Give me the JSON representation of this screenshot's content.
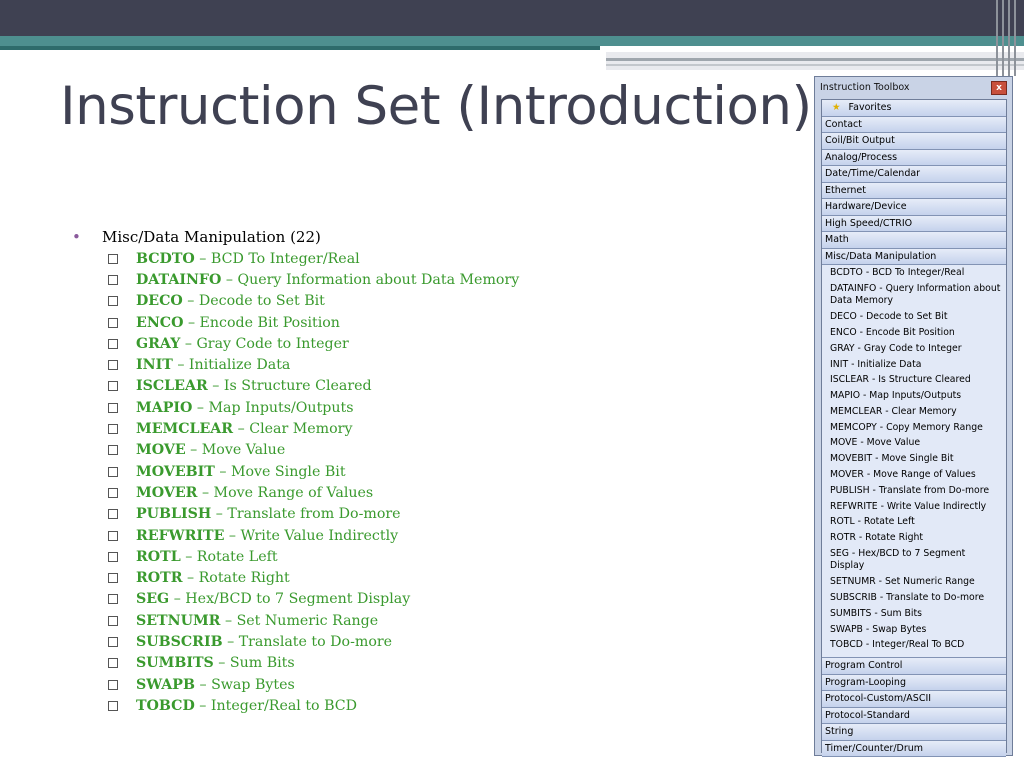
{
  "slide": {
    "title": "Instruction Set (Introduction)"
  },
  "content": {
    "section": "Misc/Data Manipulation (22)",
    "items": [
      {
        "code": "BCDTO",
        "desc": " – BCD To Integer/Real"
      },
      {
        "code": "DATAINFO",
        "desc": " – Query Information about Data Memory"
      },
      {
        "code": "DECO",
        "desc": " – Decode to Set Bit"
      },
      {
        "code": "ENCO",
        "desc": " – Encode Bit Position"
      },
      {
        "code": "GRAY",
        "desc": " – Gray Code to Integer"
      },
      {
        "code": "INIT",
        "desc": " – Initialize Data"
      },
      {
        "code": "ISCLEAR",
        "desc": " – Is Structure Cleared"
      },
      {
        "code": "MAPIO",
        "desc": " – Map Inputs/Outputs"
      },
      {
        "code": "MEMCLEAR",
        "desc": " – Clear Memory"
      },
      {
        "code": "MOVE",
        "desc": " – Move Value"
      },
      {
        "code": "MOVEBIT",
        "desc": " – Move Single Bit"
      },
      {
        "code": "MOVER",
        "desc": " – Move Range of Values"
      },
      {
        "code": "PUBLISH",
        "desc": " – Translate from Do-more"
      },
      {
        "code": "REFWRITE",
        "desc": " – Write Value Indirectly"
      },
      {
        "code": "ROTL",
        "desc": " – Rotate Left"
      },
      {
        "code": "ROTR",
        "desc": " – Rotate Right"
      },
      {
        "code": "SEG",
        "desc": " – Hex/BCD to 7 Segment Display"
      },
      {
        "code": "SETNUMR",
        "desc": " – Set Numeric Range"
      },
      {
        "code": "SUBSCRIB",
        "desc": " – Translate to Do-more"
      },
      {
        "code": "SUMBITS",
        "desc": " – Sum Bits"
      },
      {
        "code": "SWAPB",
        "desc": " – Swap Bytes"
      },
      {
        "code": "TOBCD",
        "desc": " – Integer/Real to BCD"
      }
    ]
  },
  "toolbox": {
    "title": "Instruction Toolbox",
    "close_label": "x",
    "favorites": "Favorites",
    "categories_top": [
      "Contact",
      "Coil/Bit Output",
      "Analog/Process",
      "Date/Time/Calendar",
      "Ethernet",
      "Hardware/Device",
      "High Speed/CTRIO",
      "Math",
      "Misc/Data Manipulation"
    ],
    "expanded_items": [
      "BCDTO - BCD To Integer/Real",
      "DATAINFO - Query Information about Data Memory",
      "DECO - Decode to Set Bit",
      "ENCO - Encode Bit Position",
      "GRAY - Gray Code to Integer",
      "INIT - Initialize Data",
      "ISCLEAR - Is Structure Cleared",
      "MAPIO - Map Inputs/Outputs",
      "MEMCLEAR - Clear Memory",
      "MEMCOPY - Copy Memory Range",
      "MOVE - Move Value",
      "MOVEBIT - Move Single Bit",
      "MOVER - Move Range of Values",
      "PUBLISH - Translate from Do-more",
      "REFWRITE - Write Value Indirectly",
      "ROTL - Rotate Left",
      "ROTR - Rotate Right",
      "SEG - Hex/BCD to 7 Segment Display",
      "SETNUMR - Set Numeric Range",
      "SUBSCRIB - Translate to Do-more",
      "SUMBITS - Sum Bits",
      "SWAPB - Swap Bytes",
      "TOBCD - Integer/Real To BCD"
    ],
    "categories_bottom": [
      "Program Control",
      "Program-Looping",
      "Protocol-Custom/ASCII",
      "Protocol-Standard",
      "String",
      "Timer/Counter/Drum"
    ]
  },
  "colors": {
    "title": "#3f4152",
    "band_dark": "#3f4152",
    "band_teal": "#4e8f8f",
    "instruction_green": "#3a9a2e",
    "bullet_purple": "#8a5a9c"
  }
}
